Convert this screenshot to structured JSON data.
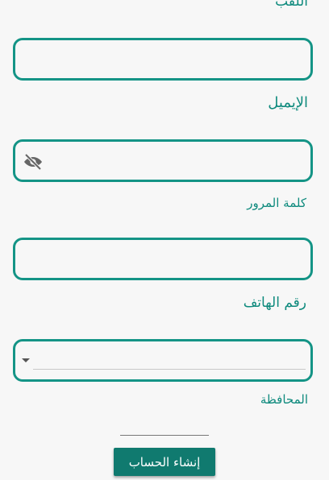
{
  "form": {
    "title_label": "اللقب",
    "email_label": "الإيميل",
    "password_label": "كلمة المرور",
    "phone_label": "رقم الهاتف",
    "governorate_label": "المحافظة",
    "title_value": "",
    "email_value": "",
    "password_value": "",
    "phone_value": "",
    "governorate_value": "",
    "submit_label": "إنشاء الحساب"
  },
  "icons": {
    "password_toggle": "eye-off-icon",
    "dropdown": "caret-down-icon"
  },
  "colors": {
    "accent": "#149486",
    "label": "#0e8a7d",
    "button": "#107a6f",
    "background": "#f7f7f7"
  }
}
